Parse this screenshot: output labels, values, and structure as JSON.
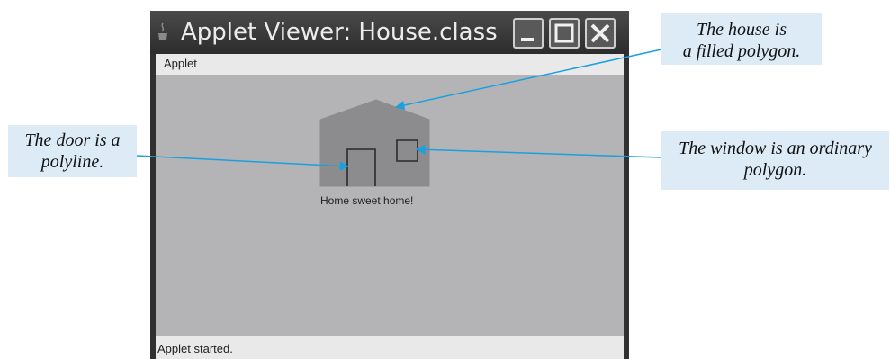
{
  "window": {
    "title": "Applet Viewer: House.class"
  },
  "menu": {
    "applet_label": "Applet"
  },
  "canvas": {
    "caption": "Home sweet home!"
  },
  "status": {
    "text": "Applet started."
  },
  "annotations": {
    "house": {
      "line1": "The house is",
      "line2": "a filled polygon."
    },
    "door": {
      "line1": "The door is a",
      "line2": "polyline."
    },
    "window": {
      "line1": "The window is an ordinary",
      "line2": "polygon."
    }
  },
  "colors": {
    "callout_bg": "#dcebf6",
    "arrow": "#1aa0e0",
    "house_fill": "#8c8c8e",
    "canvas_bg": "#b4b4b6"
  },
  "icons": {
    "app": "java-cup-icon",
    "minimize": "minimize-icon",
    "maximize": "maximize-icon",
    "close": "close-icon"
  }
}
